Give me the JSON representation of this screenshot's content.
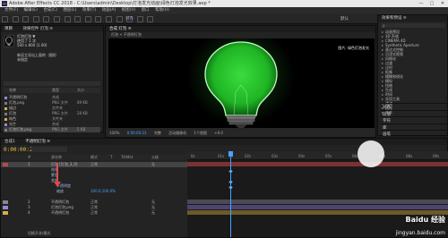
{
  "window": {
    "title": "Adobe After Effects CC 2018 - C:\\Users\\admin\\Desktop\\灯泡发光动画\\绿色灯泡发光效果.aep *",
    "logo_text": "Ae",
    "controls": [
      "—",
      "□",
      "✕"
    ]
  },
  "menu": [
    "文件(F)",
    "编辑(E)",
    "合成(C)",
    "图层(L)",
    "效果(T)",
    "动画(A)",
    "视图(V)",
    "窗口",
    "帮助(H)"
  ],
  "toolbar": {
    "snap_label": "对齐",
    "workspace": "默认"
  },
  "project_panel": {
    "tabs": [
      "项目",
      "效果控件 灯泡 ≡"
    ],
    "info_name": "灯泡灯泡 ▼",
    "info_meta": "使用了 1 次",
    "info_size": "500 x 800 (1.00)",
    "info_desc_1": "新设立导出上面的（图形",
    "info_desc_2": "未指定",
    "columns": [
      "名称",
      "类型",
      "大小"
    ],
    "rows": [
      {
        "name": "不透明灯泡",
        "type": "合成",
        "size": "",
        "color": "#9a87d6"
      },
      {
        "name": "灯泡.png",
        "type": "PNG 文件",
        "size": "89 KB",
        "color": "#7c7c7c"
      },
      {
        "name": "描边",
        "type": "文件夹",
        "size": "",
        "color": "#d3b04a"
      },
      {
        "name": "灯泡",
        "type": "PNG 文件",
        "size": "28 KB",
        "color": "#7c7c7c"
      },
      {
        "name": "纯色",
        "type": "文件夹",
        "size": "",
        "color": "#d3b04a"
      },
      {
        "name": "光芒",
        "type": "合成",
        "size": "",
        "color": "#9a87d6"
      },
      {
        "name": "灯泡灯泡.png",
        "type": "PNG 文件",
        "size": "5 KB",
        "color": "#7c7c7c"
      }
    ]
  },
  "viewer": {
    "tabs": [
      "合成 灯泡 ≡"
    ],
    "sub_tab": "灯泡 < 不透明灯泡",
    "caption": "图片: 绿色灯泡发光",
    "footer": [
      "100%",
      "0:00:00:23",
      "完整",
      "活动摄像机",
      "1个视图",
      "+0.0"
    ]
  },
  "effects_panel": {
    "tab": "效果和预设 ≡",
    "search_placeholder": "ρ",
    "items": [
      "动画预设",
      "3D 声道",
      "CINEMA 4D",
      "Synthetic Aperture",
      "表达式控制",
      "沉浸式视频",
      "风格化",
      "过渡",
      "过时",
      "抠像",
      "模糊和锐化",
      "模拟",
      "扭曲",
      "生成",
      "时间",
      "实用工具",
      "通道",
      "透视",
      "文本"
    ],
    "sections": [
      "对齐",
      "段落",
      "字符",
      "库",
      "画笔"
    ]
  },
  "timeline": {
    "tabs": [
      "合成1",
      "不透明灯泡 ≡"
    ],
    "time": "0:00:00:23",
    "headers": [
      "#",
      "源名称",
      "模式",
      "T",
      "TrkMat",
      "父级"
    ],
    "layers": [
      {
        "num": "1",
        "name": "灯泡 [灯泡_3_0]",
        "mode": "正常",
        "parent": "无",
        "color": "#b84a4a",
        "selected": true
      },
      {
        "num": "2",
        "name": "不透明灯泡",
        "mode": "正常",
        "parent": "无",
        "color": "#888",
        "selected": false
      },
      {
        "num": "3",
        "name": "灯泡灯泡.png",
        "mode": "正常",
        "parent": "无",
        "color": "#9a87d6",
        "selected": false
      },
      {
        "num": "4",
        "name": "不透明灯泡",
        "mode": "正常",
        "parent": "无",
        "color": "#d3b04a",
        "selected": false
      }
    ],
    "sub_props": [
      "效果",
      "蒙版",
      "变换",
      "不透明度",
      "缩放"
    ],
    "sub_value": "100.0,100.0%",
    "ruler_ticks": [
      "0s",
      "01s",
      "02s",
      "03s",
      "04s",
      "05s",
      "06s",
      "07s",
      "08s",
      "09s"
    ],
    "footer": "切换开关/模式"
  },
  "watermark": {
    "brand": "Baidu 经验",
    "url": "jingyan.baidu.com"
  },
  "colors": {
    "accent": "#4aa3ff",
    "glow": "#35d43a",
    "time": "#e3c54a"
  }
}
